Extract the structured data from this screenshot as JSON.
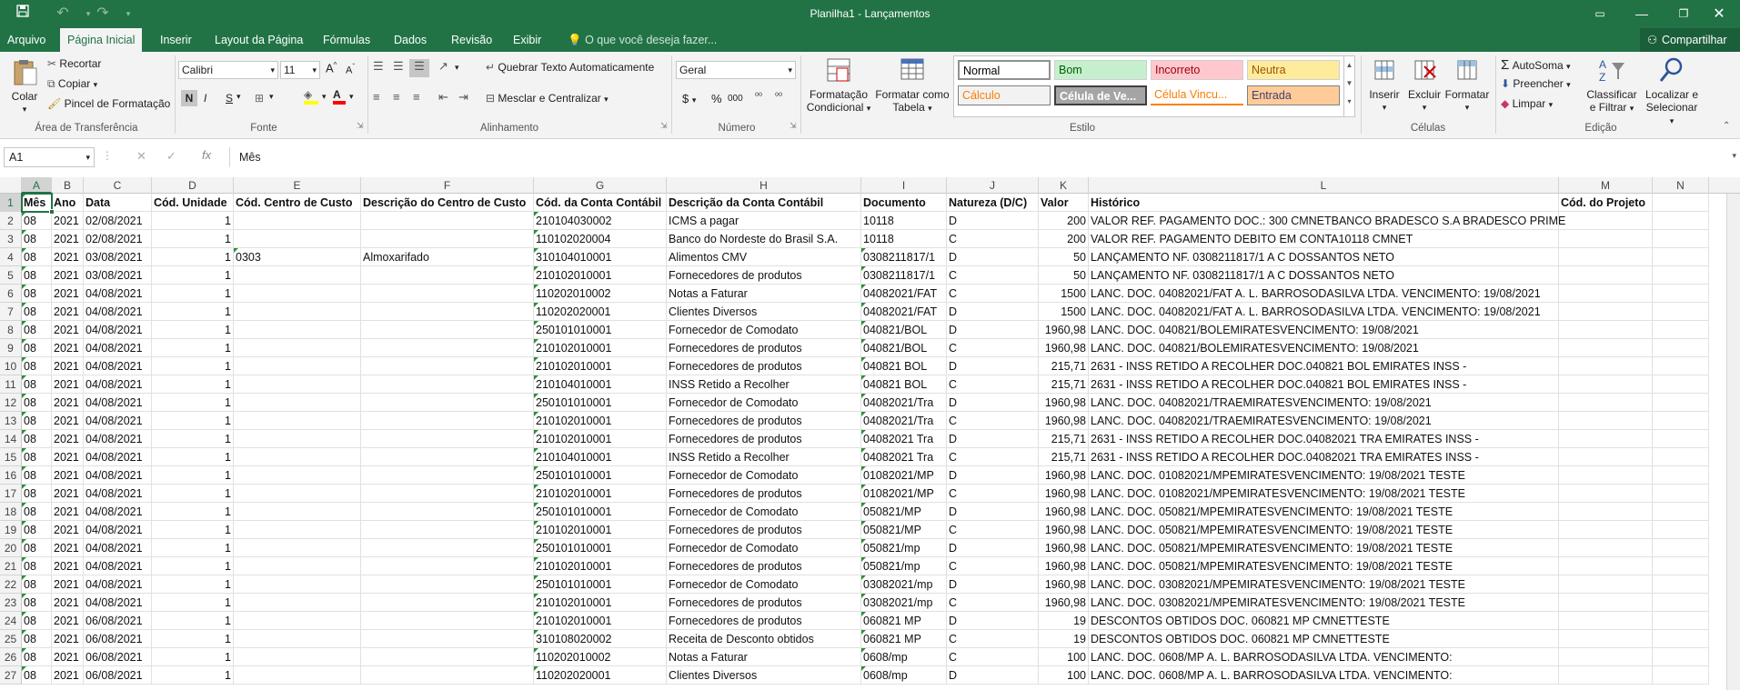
{
  "window": {
    "title": "Planilha1 - Lançamentos",
    "share_label": "Compartilhar"
  },
  "tabs": [
    "Arquivo",
    "Página Inicial",
    "Inserir",
    "Layout da Página",
    "Fórmulas",
    "Dados",
    "Revisão",
    "Exibir"
  ],
  "tell_me": "O que você deseja fazer...",
  "ribbon": {
    "clipboard": {
      "paste": "Colar",
      "cut": "Recortar",
      "copy": "Copiar",
      "format_painter": "Pincel de Formatação",
      "label": "Área de Transferência"
    },
    "font": {
      "name": "Calibri",
      "size": "11",
      "bold": "N",
      "italic": "I",
      "underline": "S",
      "label": "Fonte"
    },
    "alignment": {
      "wrap": "Quebrar Texto Automaticamente",
      "merge": "Mesclar e Centralizar",
      "label": "Alinhamento"
    },
    "number": {
      "format": "Geral",
      "label": "Número"
    },
    "styles": {
      "cond_format": "Formatação Condicional",
      "format_table": "Formatar como Tabela",
      "cells": [
        "Normal",
        "Bom",
        "Incorreto",
        "Neutra",
        "Cálculo",
        "Célula de Ve...",
        "Célula Vincu...",
        "Entrada"
      ],
      "label": "Estilo"
    },
    "cells_group": {
      "insert": "Inserir",
      "delete": "Excluir",
      "format": "Formatar",
      "label": "Células"
    },
    "editing": {
      "autosum": "AutoSoma",
      "fill": "Preencher",
      "clear": "Limpar",
      "sort": "Classificar e Filtrar",
      "find": "Localizar e Selecionar",
      "label": "Edição"
    }
  },
  "formula_bar": {
    "name_box": "A1",
    "fx": "fx",
    "content": "Mês"
  },
  "columns": [
    "A",
    "B",
    "C",
    "D",
    "E",
    "F",
    "G",
    "H",
    "I",
    "J",
    "K",
    "L",
    "M",
    "N"
  ],
  "headers": [
    "Mês",
    "Ano",
    "Data",
    "Cód. Unidade",
    "Cód. Centro de Custo",
    "Descrição do Centro de Custo",
    "Cód. da Conta Contábil",
    "Descrição da Conta Contábil",
    "Documento",
    "Natureza (D/C)",
    "Valor",
    "Histórico",
    "Cód. do Projeto",
    ""
  ],
  "rows": [
    [
      "08",
      "2021",
      "02/08/2021",
      "1",
      "",
      "",
      "210104030002",
      "ICMS a pagar",
      "10118",
      "D",
      "200",
      "VALOR REF. PAGAMENTO DOC.: 300  CMNETBANCO BRADESCO S.A BRADESCO PRIME"
    ],
    [
      "08",
      "2021",
      "02/08/2021",
      "1",
      "",
      "",
      "110102020004",
      "Banco do Nordeste do Brasil S.A.",
      "10118",
      "C",
      "200",
      "VALOR REF. PAGAMENTO DEBITO EM CONTA10118  CMNET"
    ],
    [
      "08",
      "2021",
      "03/08/2021",
      "1",
      "0303",
      "Almoxarifado",
      "310104010001",
      "Alimentos CMV",
      "0308211817/1",
      "D",
      "50",
      "LANÇAMENTO NF. 0308211817/1 A C DOSSANTOS NETO"
    ],
    [
      "08",
      "2021",
      "03/08/2021",
      "1",
      "",
      "",
      "210102010001",
      "Fornecedores de produtos",
      "0308211817/1",
      "C",
      "50",
      "LANÇAMENTO NF. 0308211817/1 A C DOSSANTOS NETO"
    ],
    [
      "08",
      "2021",
      "04/08/2021",
      "1",
      "",
      "",
      "110202010002",
      "Notas a Faturar",
      "04082021/FAT",
      "C",
      "1500",
      "LANC. DOC. 04082021/FAT A. L. BARROSODASILVA LTDA. VENCIMENTO: 19/08/2021"
    ],
    [
      "08",
      "2021",
      "04/08/2021",
      "1",
      "",
      "",
      "110202020001",
      "Clientes Diversos",
      "04082021/FAT",
      "D",
      "1500",
      "LANC. DOC. 04082021/FAT A. L. BARROSODASILVA LTDA. VENCIMENTO: 19/08/2021"
    ],
    [
      "08",
      "2021",
      "04/08/2021",
      "1",
      "",
      "",
      "250101010001",
      "Fornecedor de Comodato",
      "040821/BOL",
      "D",
      "1960,98",
      "LANC. DOC. 040821/BOLEMIRATESVENCIMENTO: 19/08/2021"
    ],
    [
      "08",
      "2021",
      "04/08/2021",
      "1",
      "",
      "",
      "210102010001",
      "Fornecedores de produtos",
      "040821/BOL",
      "C",
      "1960,98",
      "LANC. DOC. 040821/BOLEMIRATESVENCIMENTO: 19/08/2021"
    ],
    [
      "08",
      "2021",
      "04/08/2021",
      "1",
      "",
      "",
      "210102010001",
      "Fornecedores de produtos",
      "040821 BOL",
      "D",
      "215,71",
      "2631 - INSS RETIDO A RECOLHER DOC.040821 BOL EMIRATES INSS -"
    ],
    [
      "08",
      "2021",
      "04/08/2021",
      "1",
      "",
      "",
      "210104010001",
      "INSS Retido a Recolher",
      "040821 BOL",
      "C",
      "215,71",
      "2631 - INSS RETIDO A RECOLHER DOC.040821 BOL EMIRATES INSS -"
    ],
    [
      "08",
      "2021",
      "04/08/2021",
      "1",
      "",
      "",
      "250101010001",
      "Fornecedor de Comodato",
      "04082021/Tra",
      "D",
      "1960,98",
      "LANC. DOC. 04082021/TRAEMIRATESVENCIMENTO: 19/08/2021"
    ],
    [
      "08",
      "2021",
      "04/08/2021",
      "1",
      "",
      "",
      "210102010001",
      "Fornecedores de produtos",
      "04082021/Tra",
      "C",
      "1960,98",
      "LANC. DOC. 04082021/TRAEMIRATESVENCIMENTO: 19/08/2021"
    ],
    [
      "08",
      "2021",
      "04/08/2021",
      "1",
      "",
      "",
      "210102010001",
      "Fornecedores de produtos",
      "04082021 Tra",
      "D",
      "215,71",
      "2631 - INSS RETIDO A RECOLHER DOC.04082021 TRA EMIRATES INSS -"
    ],
    [
      "08",
      "2021",
      "04/08/2021",
      "1",
      "",
      "",
      "210104010001",
      "INSS Retido a Recolher",
      "04082021 Tra",
      "C",
      "215,71",
      "2631 - INSS RETIDO A RECOLHER DOC.04082021 TRA EMIRATES INSS -"
    ],
    [
      "08",
      "2021",
      "04/08/2021",
      "1",
      "",
      "",
      "250101010001",
      "Fornecedor de Comodato",
      "01082021/MP",
      "D",
      "1960,98",
      "LANC. DOC. 01082021/MPEMIRATESVENCIMENTO: 19/08/2021 TESTE"
    ],
    [
      "08",
      "2021",
      "04/08/2021",
      "1",
      "",
      "",
      "210102010001",
      "Fornecedores de produtos",
      "01082021/MP",
      "C",
      "1960,98",
      "LANC. DOC. 01082021/MPEMIRATESVENCIMENTO: 19/08/2021 TESTE"
    ],
    [
      "08",
      "2021",
      "04/08/2021",
      "1",
      "",
      "",
      "250101010001",
      "Fornecedor de Comodato",
      "050821/MP",
      "D",
      "1960,98",
      "LANC. DOC. 050821/MPEMIRATESVENCIMENTO: 19/08/2021 TESTE"
    ],
    [
      "08",
      "2021",
      "04/08/2021",
      "1",
      "",
      "",
      "210102010001",
      "Fornecedores de produtos",
      "050821/MP",
      "C",
      "1960,98",
      "LANC. DOC. 050821/MPEMIRATESVENCIMENTO: 19/08/2021 TESTE"
    ],
    [
      "08",
      "2021",
      "04/08/2021",
      "1",
      "",
      "",
      "250101010001",
      "Fornecedor de Comodato",
      "050821/mp",
      "D",
      "1960,98",
      "LANC. DOC. 050821/MPEMIRATESVENCIMENTO: 19/08/2021 TESTE"
    ],
    [
      "08",
      "2021",
      "04/08/2021",
      "1",
      "",
      "",
      "210102010001",
      "Fornecedores de produtos",
      "050821/mp",
      "C",
      "1960,98",
      "LANC. DOC. 050821/MPEMIRATESVENCIMENTO: 19/08/2021 TESTE"
    ],
    [
      "08",
      "2021",
      "04/08/2021",
      "1",
      "",
      "",
      "250101010001",
      "Fornecedor de Comodato",
      "03082021/mp",
      "D",
      "1960,98",
      "LANC. DOC. 03082021/MPEMIRATESVENCIMENTO: 19/08/2021 TESTE"
    ],
    [
      "08",
      "2021",
      "04/08/2021",
      "1",
      "",
      "",
      "210102010001",
      "Fornecedores de produtos",
      "03082021/mp",
      "C",
      "1960,98",
      "LANC. DOC. 03082021/MPEMIRATESVENCIMENTO: 19/08/2021 TESTE"
    ],
    [
      "08",
      "2021",
      "06/08/2021",
      "1",
      "",
      "",
      "210102010001",
      "Fornecedores de produtos",
      "060821 MP",
      "D",
      "19",
      "DESCONTOS OBTIDOS DOC. 060821 MP CMNETTESTE"
    ],
    [
      "08",
      "2021",
      "06/08/2021",
      "1",
      "",
      "",
      "310108020002",
      "Receita de Desconto obtidos",
      "060821 MP",
      "C",
      "19",
      "DESCONTOS OBTIDOS DOC. 060821 MP CMNETTESTE"
    ],
    [
      "08",
      "2021",
      "06/08/2021",
      "1",
      "",
      "",
      "110202010002",
      "Notas a Faturar",
      "0608/mp",
      "C",
      "100",
      "LANC. DOC. 0608/MP A. L. BARROSODASILVA LTDA. VENCIMENTO:"
    ],
    [
      "08",
      "2021",
      "06/08/2021",
      "1",
      "",
      "",
      "110202020001",
      "Clientes Diversos",
      "0608/mp",
      "D",
      "100",
      "LANC. DOC. 0608/MP A. L. BARROSODASILVA LTDA. VENCIMENTO:"
    ]
  ],
  "colors": {
    "excel_green": "#217346",
    "triangle": "#2c8f3a"
  }
}
